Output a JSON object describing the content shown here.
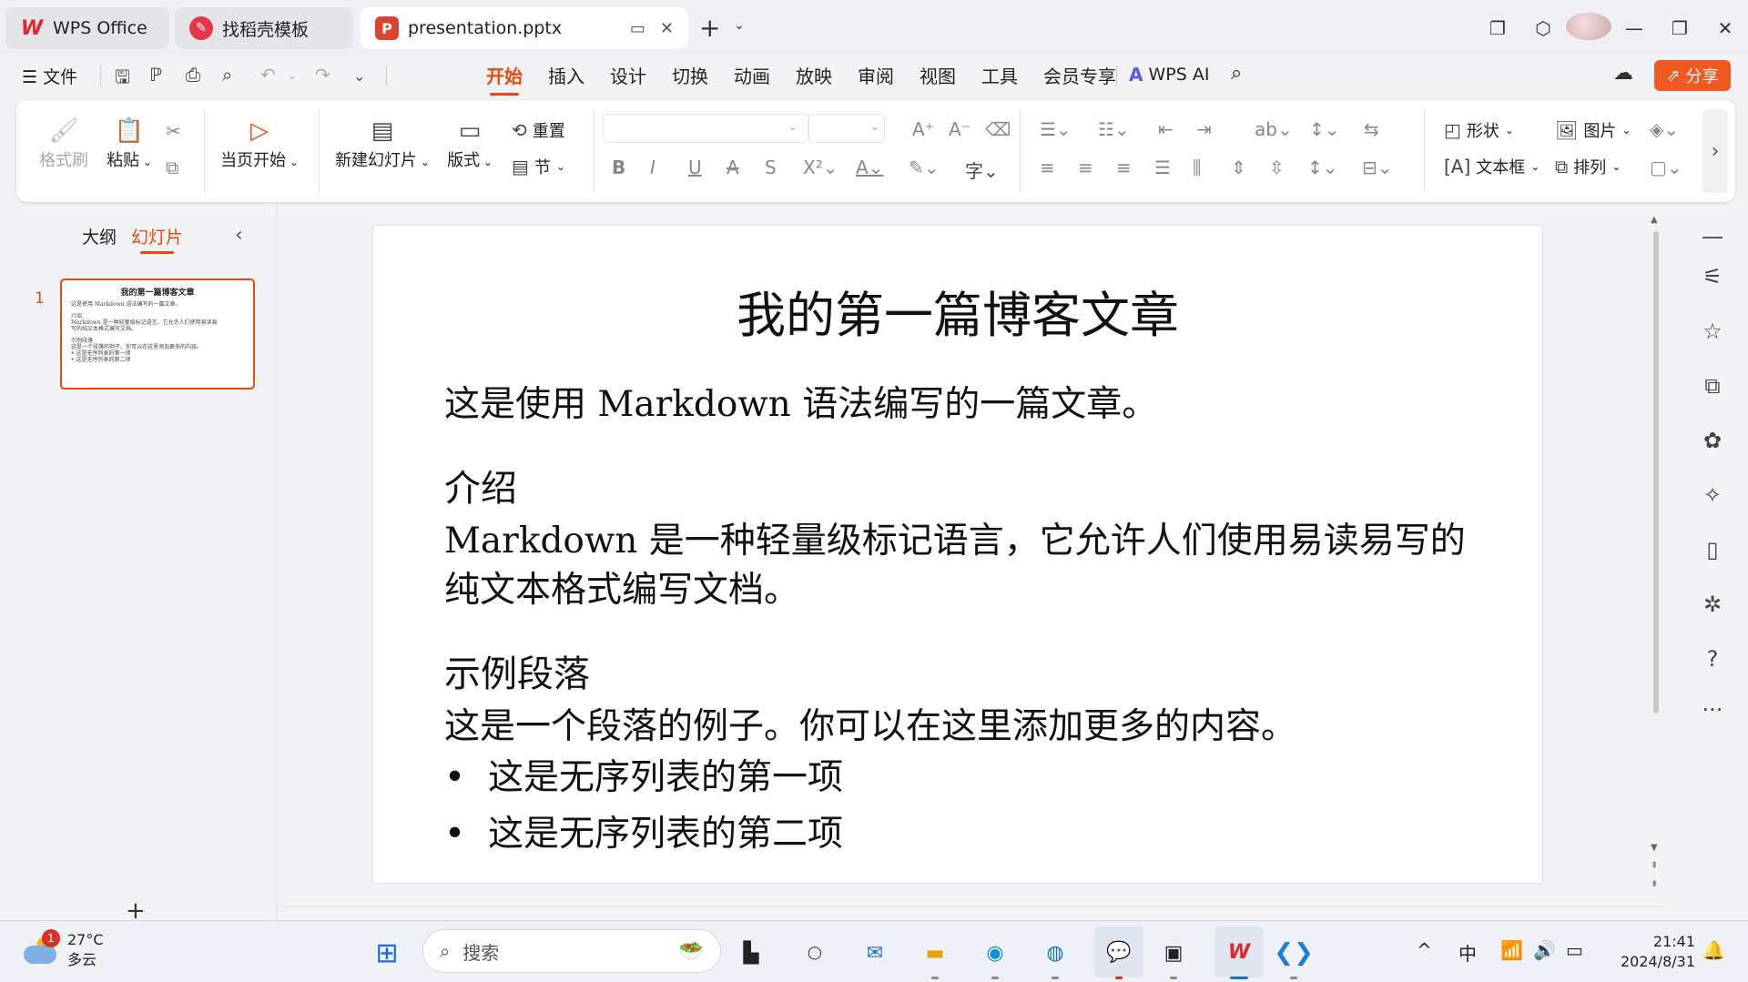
{
  "titlebar": {
    "tabs": [
      {
        "label": "WPS Office",
        "icon": "wps-logo-icon"
      },
      {
        "label": "找稻壳模板",
        "icon": "daoke-logo-icon"
      },
      {
        "label": "presentation.pptx",
        "icon": "presentation-file-icon"
      }
    ]
  },
  "menubar": {
    "file_label": "文件",
    "tabs": [
      "开始",
      "插入",
      "设计",
      "切换",
      "动画",
      "放映",
      "审阅",
      "视图",
      "工具",
      "会员专享"
    ],
    "active_tab": "开始",
    "ai_label": "WPS AI",
    "share_label": "分享"
  },
  "ribbon": {
    "format_painter": "格式刷",
    "paste": "粘贴",
    "play_from_current": "当页开始",
    "new_slide": "新建幻灯片",
    "layout": "版式",
    "reset": "重置",
    "section": "节",
    "shape": "形状",
    "picture": "图片",
    "textbox": "文本框",
    "arrange": "排列"
  },
  "leftpanel": {
    "tab_outline": "大纲",
    "tab_slides": "幻灯片",
    "active_tab": "幻灯片",
    "slide_number": "1"
  },
  "slide": {
    "title": "我的第一篇博客文章",
    "intro": "这是使用 Markdown 语法编写的一篇文章。",
    "section1_heading": "介绍",
    "section1_text": "Markdown 是一种轻量级标记语言，它允许人们使用易读易写的纯文本格式编写文档。",
    "section2_heading": "示例段落",
    "section2_text": "这是一个段落的例子。你可以在这里添加更多的内容。",
    "bullets": [
      "这是无序列表的第一项",
      "这是无序列表的第二项"
    ]
  },
  "thumbnail": {
    "title": "我的第一篇博客文章",
    "lines": [
      "这是使用 Markdown 语法编写的一篇文章。",
      "介绍",
      "Markdown 是一种轻量级标记语言，它允许人们使用易读易",
      "写的纯文本格式编写文档。",
      "示例段落",
      "这是一个段落的例子。你可以在这里添加更多的内容。",
      "• 这是无序列表的第一项",
      "• 这是无序列表的第二项"
    ]
  },
  "taskbar": {
    "weather_temp": "27°C",
    "weather_desc": "多云",
    "weather_badge": "1",
    "search_placeholder": "搜索",
    "input_method": "中",
    "time": "21:41",
    "date": "2024/8/31"
  },
  "colors": {
    "accent": "#e8470f",
    "share_button": "#f05a22",
    "wps_red": "#e0282e"
  }
}
